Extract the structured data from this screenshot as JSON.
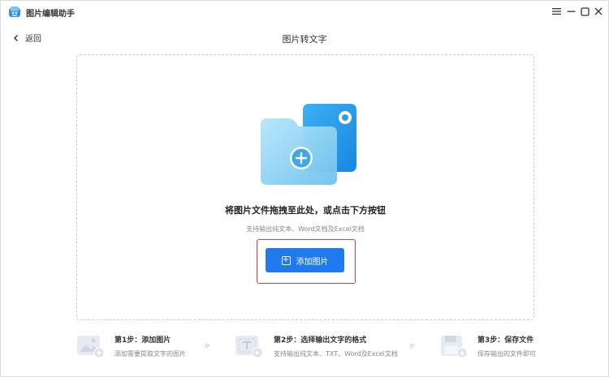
{
  "app": {
    "title": "图片编辑助手"
  },
  "window_controls": {
    "menu_icon": "menu-icon",
    "minimize_icon": "minimize-icon",
    "maximize_icon": "maximize-icon",
    "close_icon": "close-icon"
  },
  "header": {
    "back_label": "返回",
    "page_title": "图片转文字"
  },
  "dropzone": {
    "main_text": "将图片文件拖拽至此处，或点击下方按钮",
    "sub_text": "支持输出纯文本、Word文档及Excel文档",
    "button_label": "添加图片"
  },
  "steps": [
    {
      "title": "第1步：添加图片",
      "desc": "添加需要提取文字的图片",
      "icon": "image-add-icon"
    },
    {
      "title": "第2步：选择输出文字的格式",
      "desc": "支持输出纯文本、TXT、Word及Excel文档",
      "icon": "text-format-icon"
    },
    {
      "title": "第3步：保存文件",
      "desc": "保存输出的文件即可",
      "icon": "save-icon"
    }
  ],
  "colors": {
    "accent": "#1f7af0",
    "highlight": "#e13a3a",
    "folder_light": "#8fd2f4",
    "folder_dark": "#2a9ee8"
  }
}
